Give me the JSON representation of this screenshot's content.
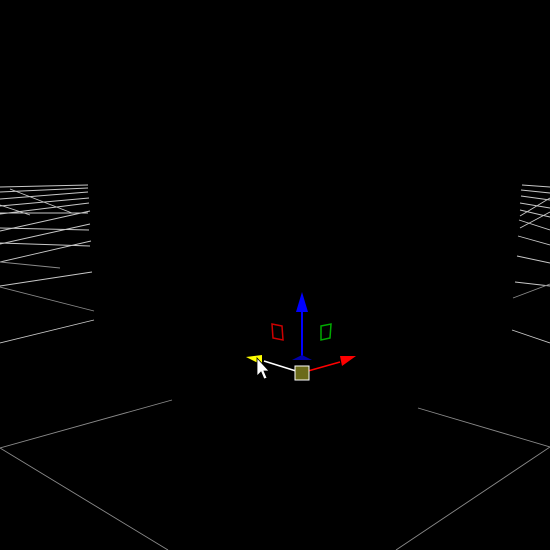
{
  "viewport": {
    "background": "#000000",
    "grid_color": "#c8c8c8",
    "wall_grid_color": "#bfbfbf"
  },
  "gizmo": {
    "axis_colors": {
      "x": "#ff0000",
      "y": "#ffff00",
      "z": "#0000ff"
    },
    "plane_handle_colors": {
      "xz": "#cc0000",
      "yz": "#00aa00"
    },
    "center_handle_color": "#6b6b1a",
    "center_handle_border": "#ffffff"
  },
  "cursor": {
    "icon": "arrow-cursor-icon",
    "color": "#ffffff"
  }
}
